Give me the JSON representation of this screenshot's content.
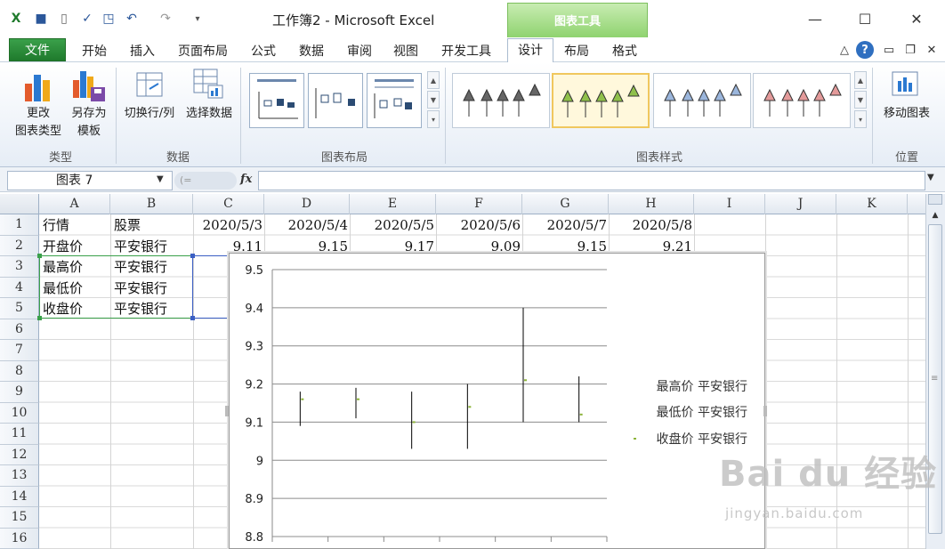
{
  "window": {
    "title": "工作簿2 - Microsoft Excel",
    "context_tab_group": "图表工具",
    "minimize_icon": "minimize-icon",
    "maximize_icon": "maximize-icon",
    "close_icon": "close-icon"
  },
  "ribbon_tabs": {
    "file": "文件",
    "items": [
      "开始",
      "插入",
      "页面布局",
      "公式",
      "数据",
      "审阅",
      "视图",
      "开发工具"
    ],
    "design": "设计",
    "layout": "布局",
    "format": "格式"
  },
  "ribbon": {
    "type_group": {
      "label": "类型",
      "change_type_l1": "更改",
      "change_type_l2": "图表类型",
      "save_template_l1": "另存为",
      "save_template_l2": "模板"
    },
    "data_group": {
      "label": "数据",
      "switch_row_col": "切换行/列",
      "select_data": "选择数据"
    },
    "layout_group": {
      "label": "图表布局"
    },
    "styles_group": {
      "label": "图表样式"
    },
    "location_group": {
      "label": "位置",
      "move_chart": "移动图表"
    }
  },
  "formula_bar": {
    "name_box": "图表 7",
    "fx": "fx",
    "formula": ""
  },
  "sheet": {
    "columns": [
      "A",
      "B",
      "C",
      "D",
      "E",
      "F",
      "G",
      "H",
      "I",
      "J",
      "K"
    ],
    "rows": [
      "1",
      "2",
      "3",
      "4",
      "5",
      "6",
      "7",
      "8",
      "9",
      "10",
      "11",
      "12",
      "13",
      "14",
      "15",
      "16"
    ],
    "r1": {
      "a": "行情",
      "b": "股票",
      "c": "2020/5/3",
      "d": "2020/5/4",
      "e": "2020/5/5",
      "f": "2020/5/6",
      "g": "2020/5/7",
      "h": "2020/5/8"
    },
    "r2": {
      "a": "开盘价",
      "b": "平安银行",
      "c": "9.11",
      "d": "9.15",
      "e": "9.17",
      "f": "9.09",
      "g": "9.15",
      "h": "9.21"
    },
    "r3": {
      "a": "最高价",
      "b": "平安银行"
    },
    "r4": {
      "a": "最低价",
      "b": "平安银行"
    },
    "r5": {
      "a": "收盘价",
      "b": "平安银行"
    }
  },
  "chart_data": {
    "type": "stock",
    "categories": [
      "2020/5/3",
      "2020/5/4",
      "2020/5/5",
      "2020/5/6",
      "2020/5/7",
      "2020/5/8"
    ],
    "series": [
      {
        "name": "最高价 平安银行",
        "values": [
          9.18,
          9.19,
          9.18,
          9.2,
          9.4,
          9.22
        ]
      },
      {
        "name": "最低价 平安银行",
        "values": [
          9.09,
          9.11,
          9.03,
          9.03,
          9.1,
          9.1
        ]
      },
      {
        "name": "收盘价 平安银行",
        "values": [
          9.16,
          9.16,
          9.1,
          9.14,
          9.21,
          9.12
        ]
      }
    ],
    "y_ticks": [
      "9.5",
      "9.4",
      "9.3",
      "9.2",
      "9.1",
      "9",
      "8.9",
      "8.8"
    ],
    "ylim": [
      8.8,
      9.5
    ],
    "grid": true,
    "legend": "right",
    "colors": {
      "hilo_line": "#000000",
      "close_marker": "#8DB43A",
      "gridline": "#8C8C8C"
    }
  },
  "watermark": {
    "brand": "Bai du 经验",
    "url": "jingyan.baidu.com"
  }
}
